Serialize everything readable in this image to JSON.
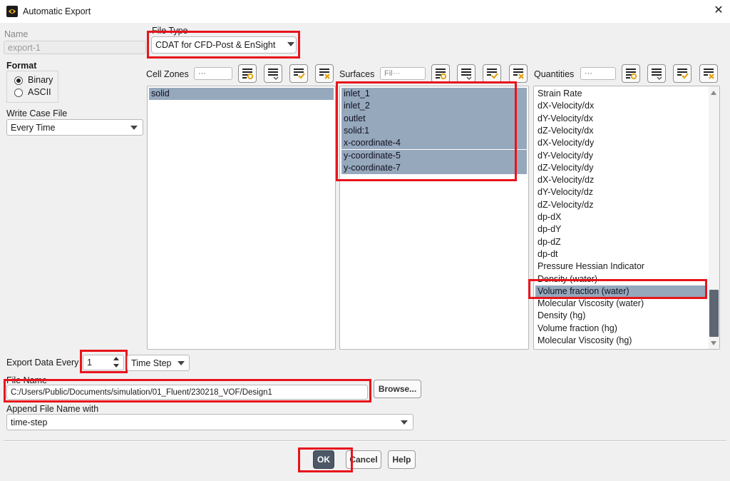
{
  "window": {
    "title": "Automatic Export"
  },
  "name_field": {
    "label": "Name",
    "value": "export-1"
  },
  "file_type": {
    "label": "File Type",
    "value": "CDAT for CFD-Post & EnSight"
  },
  "format": {
    "label": "Format",
    "options": [
      "Binary",
      "ASCII"
    ],
    "selected": "Binary"
  },
  "write_case": {
    "label": "Write Case File",
    "value": "Every Time"
  },
  "cell_zones": {
    "label": "Cell Zones",
    "filter_placeholder": "···",
    "items": [
      "solid"
    ],
    "selected": [
      "solid"
    ]
  },
  "surfaces": {
    "label": "Surfaces",
    "filter_placeholder": "Fil···",
    "items": [
      "inlet_1",
      "inlet_2",
      "outlet",
      "solid:1",
      "x-coordinate-4",
      "y-coordinate-5",
      "y-coordinate-7"
    ],
    "selected": [
      "inlet_1",
      "inlet_2",
      "outlet",
      "solid:1",
      "x-coordinate-4",
      "y-coordinate-5",
      "y-coordinate-7"
    ]
  },
  "quantities": {
    "label": "Quantities",
    "filter_placeholder": "···",
    "items": [
      "Strain Rate",
      "dX-Velocity/dx",
      "dY-Velocity/dx",
      "dZ-Velocity/dx",
      "dX-Velocity/dy",
      "dY-Velocity/dy",
      "dZ-Velocity/dy",
      "dX-Velocity/dz",
      "dY-Velocity/dz",
      "dZ-Velocity/dz",
      "dp-dX",
      "dp-dY",
      "dp-dZ",
      "dp-dt",
      "Pressure Hessian Indicator",
      "Density (water)",
      "Volume fraction (water)",
      "Molecular Viscosity (water)",
      "Density (hg)",
      "Volume fraction (hg)",
      "Molecular Viscosity (hg)"
    ],
    "selected": [
      "Volume fraction (water)"
    ]
  },
  "export_every": {
    "label": "Export Data Every",
    "value": "1",
    "unit": "Time Step"
  },
  "file_name": {
    "label": "File Name",
    "value": "C:/Users/Public/Documents/simulation/01_Fluent/230218_VOF/Design1",
    "browse_label": "Browse..."
  },
  "append": {
    "label": "Append File Name with",
    "value": "time-step"
  },
  "buttons": {
    "ok": "OK",
    "cancel": "Cancel",
    "help": "Help"
  },
  "colors": {
    "selection": "#96a8bc",
    "highlight_box": "#e8141c",
    "ok_button": "#4d5866"
  }
}
